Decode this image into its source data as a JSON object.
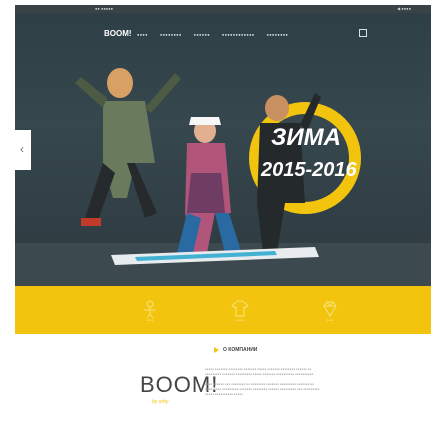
{
  "statusbar": {
    "left": "●● ●●●●●",
    "right": "◀ ●●●●"
  },
  "nav": {
    "logo": "BOOM!",
    "items": [
      "●●●●",
      "●●●●●●●●",
      "●●●●●●",
      "●●●●●●●●●●●●",
      "●●●●●●●●"
    ],
    "search_icon": "search-icon"
  },
  "hero": {
    "title_winter": "ЗИМА",
    "title_years": "2015-2016"
  },
  "band": {
    "items": [
      {
        "icon": "child-icon",
        "label": "●●●●"
      },
      {
        "icon": "tshirt-icon",
        "label": "●●●●●"
      },
      {
        "icon": "diamond-icon",
        "label": "●●●●"
      }
    ]
  },
  "about": {
    "title": "О КОМПАНИИ",
    "brand_name": "BOOM!",
    "brand_sub": "by orby",
    "paragraph1": "●●●●● ●●●●●●● ●●●●●●●● ●●●●●●● ●●●●● ●●●●●●● ●●●●●●●● ●●●●●● ●● ●●●●●●●●● ●●●●●●● ●●●●●●●●● ●●●●● ●●●●●●● ●●●●●●●●●● ●●●●●●●●●●",
    "paragraph2": "●●●● ●●●●●● ●●● ●●●●●●●● ●● ●●●●●●●● ●●●●●●● ●●●●●●●●● ●●●●●●● ●● ●●●●●●●●● ●●●●●●●●● ●●●●●●● ●●●●●●●● ●●●●●● ●●●●●●●●● ●●● ●●●●●●●●● ●●●●● ●●●●●●●●●● ●●●●●"
  },
  "colors": {
    "accent": "#f2c40d",
    "hero_bg": "#2e3f46"
  }
}
